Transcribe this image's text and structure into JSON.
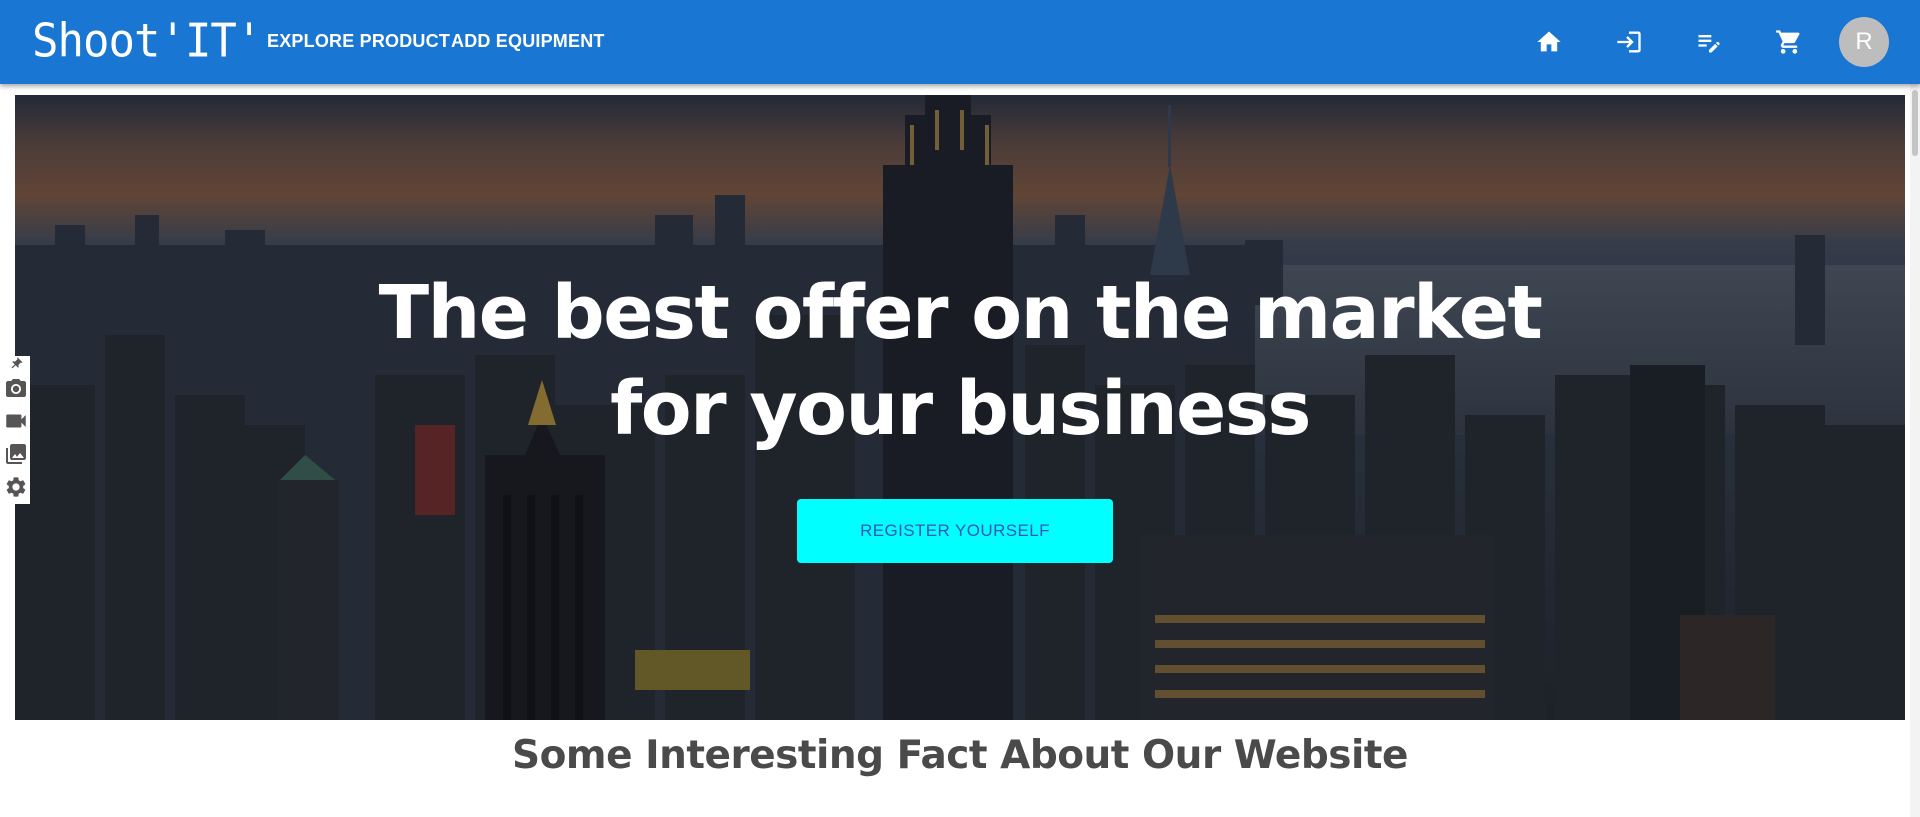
{
  "appbar": {
    "logo": "Shoot'IT'",
    "nav": {
      "explore_label": "EXPLORE PRODUCT",
      "add_label": "ADD EQUIPMENT"
    },
    "icons": [
      "home-icon",
      "login-icon",
      "edit-note-icon",
      "cart-icon"
    ],
    "avatar_initial": "R",
    "background_color": "#1976d2"
  },
  "hero": {
    "title_line1": "The best offer on the market",
    "title_line2": "for your business",
    "register_label": "REGISTER YOURSELF",
    "button_color": "#00ffff",
    "button_text_color": "#3b55b8"
  },
  "side_tools": [
    "pin-icon",
    "camera-icon",
    "video-icon",
    "gallery-icon",
    "settings-icon"
  ],
  "section": {
    "title": "Some Interesting Fact About Our Website"
  }
}
